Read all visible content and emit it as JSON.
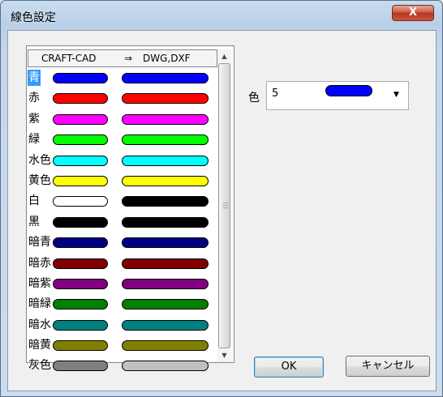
{
  "window": {
    "title": "線色設定",
    "close_glyph": "X"
  },
  "list": {
    "header_from": "CRAFT-CAD",
    "header_arrow": "⇒",
    "header_to": "DWG,DXF",
    "selected_index": 0,
    "rows": [
      {
        "label": "青",
        "from_color": "#0000ff",
        "to_color": "#0000ff"
      },
      {
        "label": "赤",
        "from_color": "#ff0000",
        "to_color": "#ff0000"
      },
      {
        "label": "紫",
        "from_color": "#ff00ff",
        "to_color": "#ff00ff"
      },
      {
        "label": "緑",
        "from_color": "#00ff00",
        "to_color": "#00ff00"
      },
      {
        "label": "水色",
        "from_color": "#00ffff",
        "to_color": "#00ffff"
      },
      {
        "label": "黄色",
        "from_color": "#ffff00",
        "to_color": "#ffff00"
      },
      {
        "label": "白",
        "from_color": "#ffffff",
        "to_color": "#000000"
      },
      {
        "label": "黒",
        "from_color": "#000000",
        "to_color": "#000000"
      },
      {
        "label": "暗青",
        "from_color": "#000080",
        "to_color": "#000080"
      },
      {
        "label": "暗赤",
        "from_color": "#800000",
        "to_color": "#800000"
      },
      {
        "label": "暗紫",
        "from_color": "#800080",
        "to_color": "#800080"
      },
      {
        "label": "暗緑",
        "from_color": "#008000",
        "to_color": "#008000"
      },
      {
        "label": "暗水",
        "from_color": "#008080",
        "to_color": "#008080"
      },
      {
        "label": "暗黄",
        "from_color": "#808000",
        "to_color": "#808000"
      },
      {
        "label": "灰色",
        "from_color": "#808080",
        "to_color": "#c0c0c0"
      }
    ]
  },
  "color_select": {
    "label": "色",
    "value": "5",
    "swatch_color": "#0000ff"
  },
  "buttons": {
    "ok": "OK",
    "cancel": "キャンセル"
  },
  "icons": {
    "close": "close-icon",
    "scroll_up": "chevron-up-icon",
    "scroll_down": "chevron-down-icon",
    "combo_arrow": "chevron-down-icon",
    "grip": "grip-icon"
  }
}
